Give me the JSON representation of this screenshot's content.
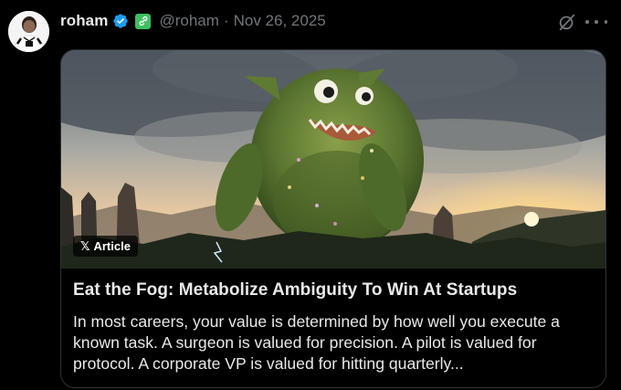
{
  "author": {
    "name": "roham",
    "handle": "@roham",
    "separator": "·",
    "date": "Nov 26, 2025",
    "verified": true,
    "affiliation_badge": "link-badge-icon"
  },
  "header_actions": {
    "grok_icon": "grok-icon",
    "more_icon": "more-horizontal-icon"
  },
  "article": {
    "badge_logo": "𝕏",
    "badge_label": "Article",
    "title": "Eat the Fog: Metabolize Ambiguity To Win At Startups",
    "excerpt": "In most careers, your value is determined by how well you execute a known task. A surgeon is valued for precision. A pilot is valued for protocol. A corporate VP is valued for hitting quarterly..."
  },
  "colors": {
    "background": "#000000",
    "text": "#e7e9ea",
    "muted": "#71767b",
    "verified_blue": "#1d9bf0",
    "affiliation_green": "#3fbf62",
    "card_border": "#2f3336"
  }
}
